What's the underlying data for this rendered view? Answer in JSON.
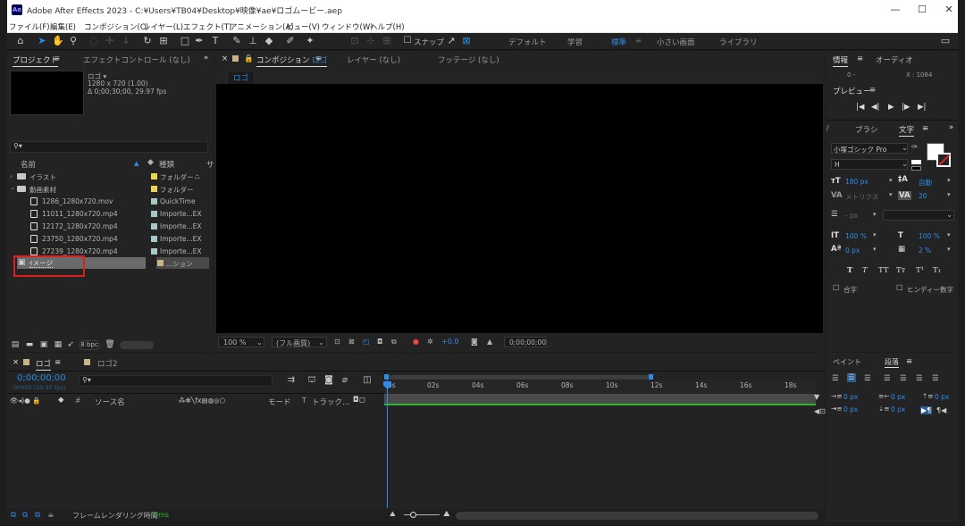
{
  "window": {
    "app_icon": "Ae",
    "title": "Adobe After Effects 2023 - C:¥Users¥TB04¥Desktop¥映像¥ae¥ロゴムービー.aep",
    "minimize": "—",
    "maximize": "☐",
    "close": "✕"
  },
  "menu": [
    "ファイル(F)",
    "編集(E)",
    "コンポジション(C)",
    "レイヤー(L)",
    "エフェクト(T)",
    "アニメーション(A)",
    "ビュー(V)",
    "ウィンドウ(W)",
    "ヘルプ(H)"
  ],
  "toolbar": {
    "snap_label": "スナップ",
    "workspaces": [
      "デフォルト",
      "学習",
      "標準",
      "小さい画面",
      "ライブラリ"
    ],
    "active_workspace": "標準",
    "workspace_menu": "≡"
  },
  "project": {
    "tab": "プロジェクト",
    "tab_menu": "≡",
    "effects_tab": "エフェクトコントロール (なし)",
    "overflow": "»",
    "info_name": "ロゴ ▾",
    "info_size": "1280 x 720 (1.00)",
    "info_duration": "Δ 0;00;30;00, 29.97 fps",
    "search_icon": "⚲▾",
    "col_name": "名前",
    "col_type": "種類",
    "col_size": "サ",
    "items": [
      {
        "name": "イラスト",
        "type": "フォルダー",
        "color": "#e6d84a",
        "kind": "folder",
        "expander": "›"
      },
      {
        "name": "動画素材",
        "type": "フォルダー",
        "color": "#e6d84a",
        "kind": "folder",
        "expander": "⌄"
      },
      {
        "name": "1286_1280x720.mov",
        "type": "QuickTime",
        "color": "#a7c9c6",
        "kind": "file"
      },
      {
        "name": "11011_1280x720.mp4",
        "type": "Importe...EX",
        "color": "#a7c9c6",
        "kind": "file"
      },
      {
        "name": "12172_1280x720.mp4",
        "type": "Importe...EX",
        "color": "#a7c9c6",
        "kind": "file"
      },
      {
        "name": "23750_1280x720.mp4",
        "type": "Importe...EX",
        "color": "#a7c9c6",
        "kind": "file"
      },
      {
        "name": "27239_1280x720.mp4",
        "type": "Importe...EX",
        "color": "#a7c9c6",
        "kind": "file"
      },
      {
        "name": "ｲメージ",
        "type": "...ション",
        "color": "#c9b48a",
        "kind": "comp"
      }
    ],
    "bpc": "8 bpc"
  },
  "composition": {
    "close": "×",
    "tab": "コンポジション",
    "comp_name": "ロゴ",
    "tab_menu": "≡",
    "layer_tab": "レイヤー (なし)",
    "footage_tab": "フッテージ (なし)",
    "subtab": "ロゴ",
    "zoom": "100 %",
    "resolution": "(フル画質)",
    "exposure": "+0.0",
    "timecode": "0;00;00;00"
  },
  "right_panel": {
    "info_tab": "情報",
    "tab_menu": "≡",
    "audio_tab": "オーディオ",
    "readout_r": "0 -",
    "readout_x": "X : 1084",
    "preview_tab": "プレビュー",
    "preview_buttons": [
      "|◀",
      "◀|",
      "▶",
      "|▶",
      "▶|"
    ],
    "side_mark": "/",
    "brush_tab": "ブラシ",
    "char_tab": "文字",
    "overflow": "»",
    "font": "小塚ゴシック Pro",
    "font_style": "H",
    "font_size": "180 px",
    "leading": "自動",
    "kerning": "メトリクス",
    "tracking": "20",
    "stroke": "- px",
    "vscale": "100 %",
    "hscale": "100 %",
    "baseline": "0 px",
    "tsume": "2 %",
    "style_buttons": [
      "T",
      "T",
      "TT",
      "Tт",
      "T¹",
      "T₁"
    ],
    "ligature": "合字",
    "hindi": "ヒンディー数字",
    "paint_tab": "ペイント",
    "para_tab": "段落",
    "indent_vals": [
      "0 px",
      "0 px",
      "0 px",
      "0 px",
      "0 px"
    ]
  },
  "timeline": {
    "close": "×",
    "tab": "ロゴ",
    "tab_menu": "≡",
    "tab2": "ロゴ2",
    "timecode": "0;00;00;00",
    "frames": "00000 (29.97 fps)",
    "search": "⚲▾",
    "col_source": "ソース名",
    "col_mode": "モード",
    "col_t": "T",
    "col_track": "トラック...",
    "ruler": [
      "0s",
      "02s",
      "04s",
      "06s",
      "08s",
      "10s",
      "12s",
      "14s",
      "16s",
      "18s"
    ],
    "render_label": "フレームレンダリング時間",
    "render_value": "0ms"
  },
  "colors": {
    "accent": "#2d8ceb",
    "selection_box": "#e01e1e",
    "work_area": "#2fb82f"
  }
}
